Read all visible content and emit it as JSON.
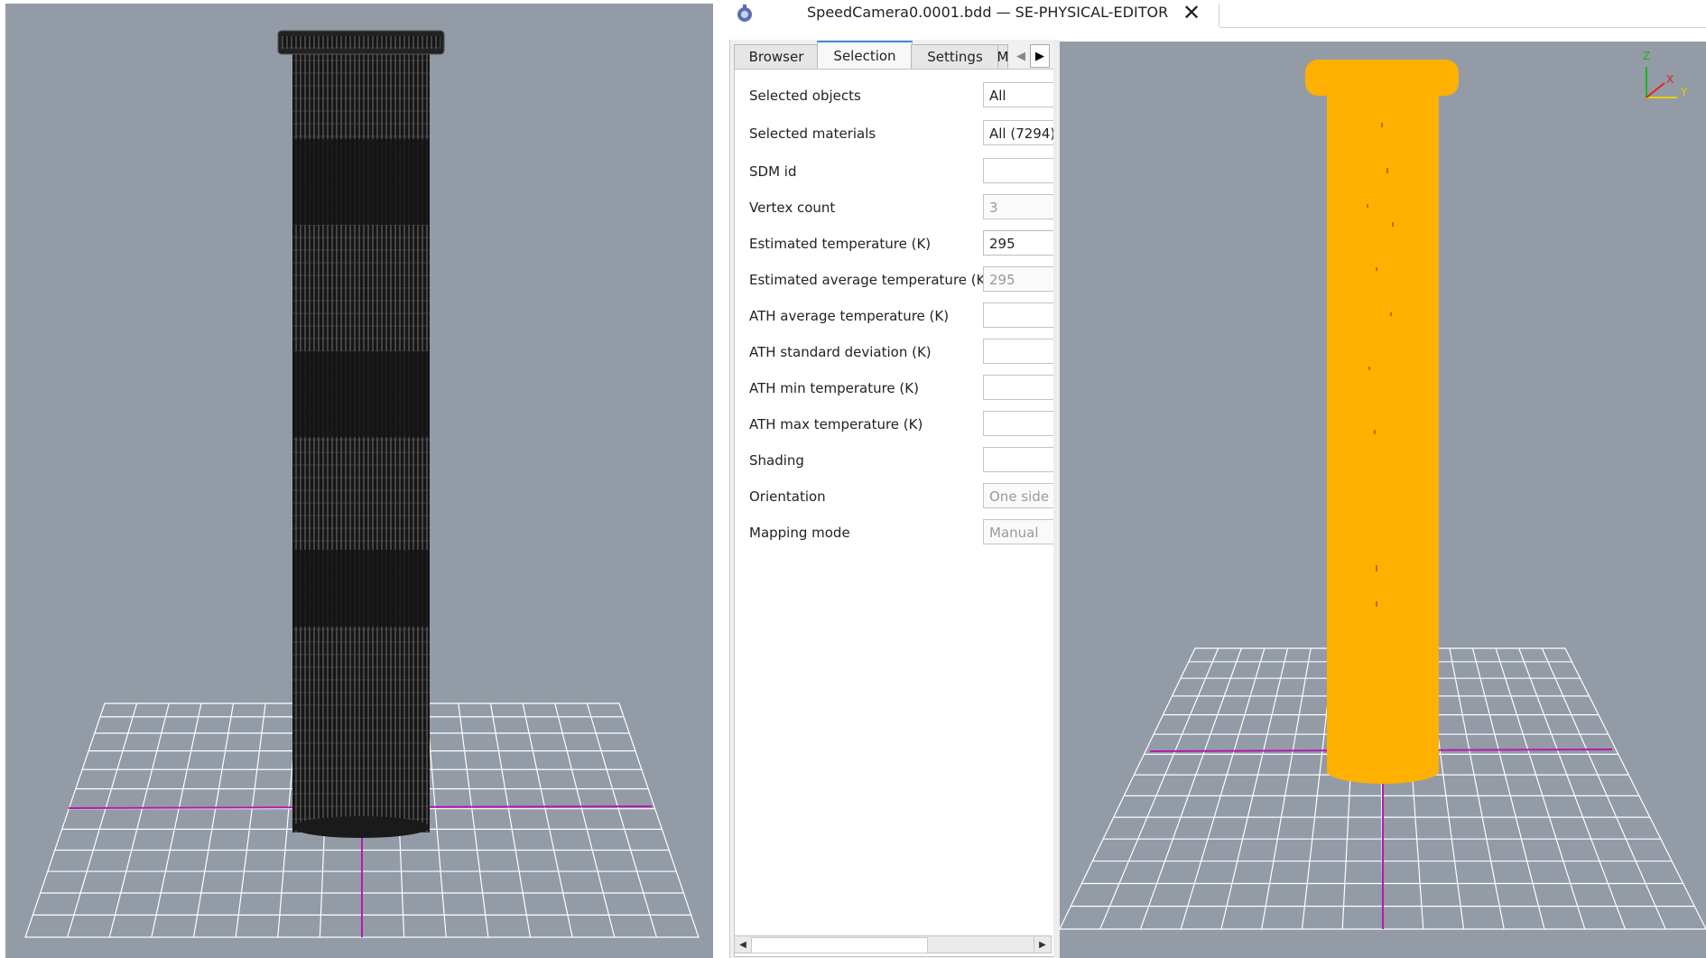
{
  "window": {
    "title": "SpeedCamera0.0001.bdd — SE-PHYSICAL-EDITOR",
    "close_glyph": "✕"
  },
  "tabs": [
    {
      "label": "Browser",
      "active": false
    },
    {
      "label": "Selection",
      "active": true
    },
    {
      "label": "Settings",
      "active": false
    },
    {
      "label": "M",
      "active": false
    }
  ],
  "tab_scroll": {
    "left_glyph": "◀",
    "right_glyph": "▶"
  },
  "properties": [
    {
      "label": "Selected objects",
      "value": "All",
      "state": "normal"
    },
    {
      "label": "Selected materials",
      "value": "All (7294)",
      "state": "normal"
    },
    {
      "label": "SDM id",
      "value": "",
      "state": "normal"
    },
    {
      "label": "Vertex count",
      "value": "3",
      "state": "disabled"
    },
    {
      "label": "Estimated temperature (K)",
      "value": "295",
      "state": "editable"
    },
    {
      "label": "Estimated average temperature (K)",
      "value": "295",
      "state": "disabled"
    },
    {
      "label": "ATH average temperature (K)",
      "value": "",
      "state": "normal"
    },
    {
      "label": "ATH standard deviation (K)",
      "value": "",
      "state": "normal"
    },
    {
      "label": "ATH min temperature (K)",
      "value": "",
      "state": "normal"
    },
    {
      "label": "ATH max temperature (K)",
      "value": "",
      "state": "normal"
    },
    {
      "label": "Shading",
      "value": "",
      "state": "normal"
    },
    {
      "label": "Orientation",
      "value": "One side",
      "state": "disabled"
    },
    {
      "label": "Mapping mode",
      "value": "Manual",
      "state": "disabled"
    }
  ],
  "scrollbar": {
    "left_glyph": "◀",
    "right_glyph": "▶",
    "thumb_fraction": 0.58
  },
  "axis_gizmo": {
    "z": "Z",
    "x": "X",
    "y": "Y"
  },
  "colors": {
    "viewport_bg": "#939ba6",
    "grid": "#ffffff",
    "grid_axis": "#b31bb3",
    "wireframe": "#111111",
    "solid_model": "#ffb000",
    "axis_x": "#e2231a",
    "axis_y": "#e8d000",
    "axis_z": "#1cb21c"
  },
  "icons": {
    "app": "app-logo-icon",
    "close": "close-icon"
  }
}
